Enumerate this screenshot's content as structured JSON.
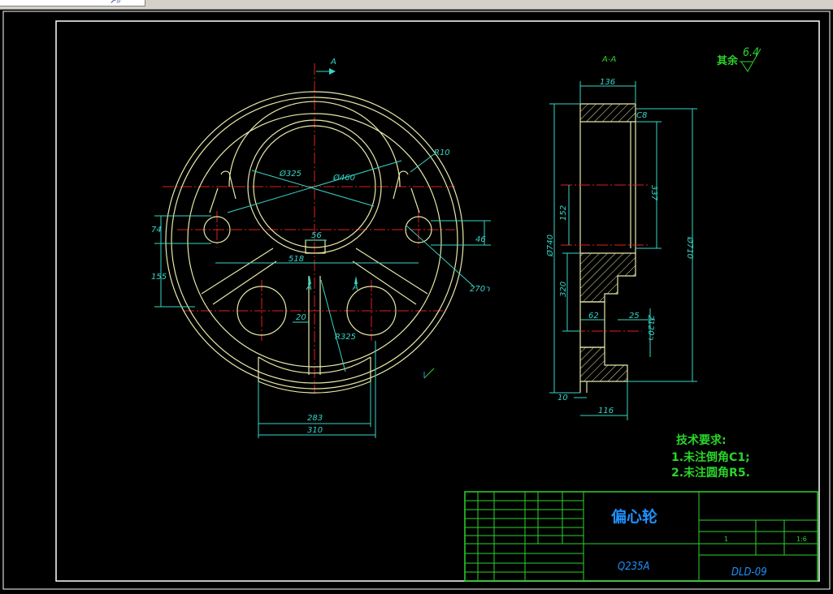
{
  "window": {
    "toolbar_glyph": "↗⌕"
  },
  "colors": {
    "background": "#000000",
    "outline": "#e8e8a8",
    "dimension": "#36d6c8",
    "centerline": "#e02020",
    "frame": "#ffffff",
    "text_blue": "#1e90ff",
    "title_block": "#2ad42a"
  },
  "front_view": {
    "section_mark_top": "A",
    "section_mark_left": "A",
    "section_mark_right": "A",
    "dims": {
      "d_325": "Ø325",
      "d_460": "Ø460",
      "r10": "R10",
      "v74": "74",
      "v155": "155",
      "v46": "46",
      "h56": "56",
      "h518": "518",
      "hole_2x70": "2ר70",
      "h20": "20",
      "r325": "R325",
      "h283": "283",
      "h310": "310"
    }
  },
  "section_view": {
    "title": "A-A",
    "dims": {
      "w136": "136",
      "chamfer": "C8",
      "v337": "337",
      "v152": "152",
      "d740": "Ø740",
      "d710": "Ø710",
      "v320": "320",
      "w62": "62",
      "w25": "25",
      "holes_120": "2ר120",
      "w10": "10",
      "w116": "116"
    }
  },
  "roughness": {
    "label": "其余",
    "value": "6.4"
  },
  "notes": {
    "title": "技术要求:",
    "items": [
      "1.未注倒角C1;",
      "2.未注圆角R5."
    ]
  },
  "title_block": {
    "part_name": "偏心轮",
    "material": "Q235A",
    "drawing_number": "DLD-09",
    "qty": "1",
    "scale": "1:6"
  }
}
